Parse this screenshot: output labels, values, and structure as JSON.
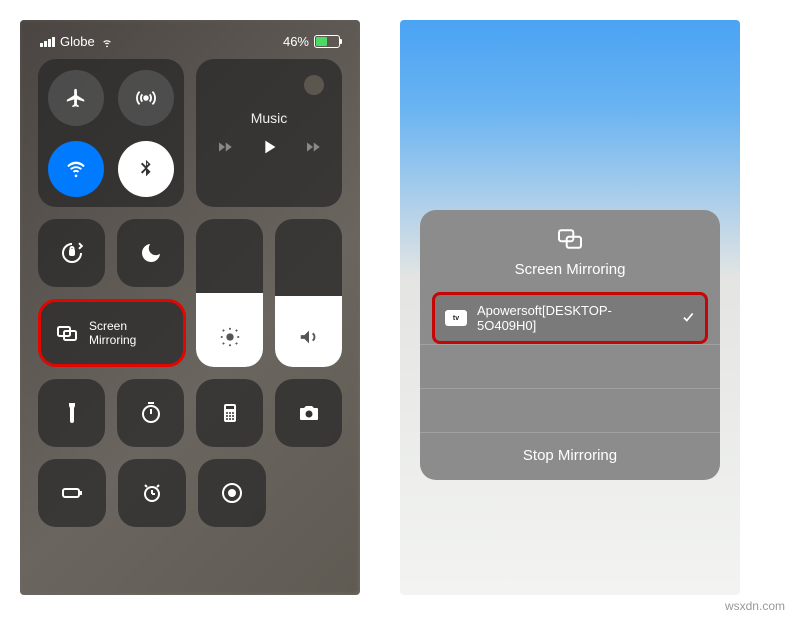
{
  "status": {
    "carrier": "Globe",
    "battery_text": "46%",
    "battery_level": 46
  },
  "controlCenter": {
    "music": {
      "label": "Music"
    },
    "screenMirroring": {
      "line1": "Screen",
      "line2": "Mirroring"
    }
  },
  "mirrorSheet": {
    "title": "Screen Mirroring",
    "device": "Apowersoft[DESKTOP-5O409H0]",
    "stop": "Stop Mirroring"
  },
  "watermark": "wsxdn.com"
}
